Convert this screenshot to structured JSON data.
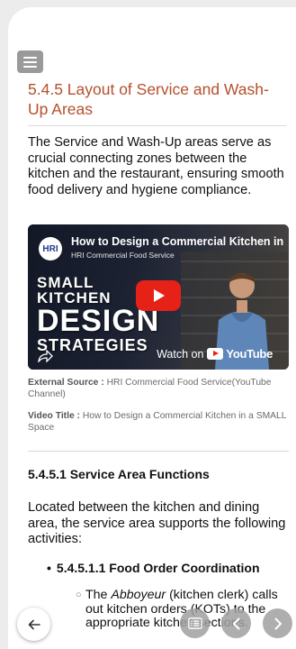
{
  "section": {
    "title": "5.4.5 Layout of Service and Wash-Up Areas",
    "intro": "The Service and Wash-Up areas serve as crucial connecting zones between the kitchen and the restaurant, ensuring smooth food delivery and hygiene compliance."
  },
  "video": {
    "channel_logo": "HRI",
    "title": "How to Design a Commercial Kitchen in a SMALL Space",
    "channel": "HRI Commercial Food Service",
    "thumb_line1": "SMALL",
    "thumb_line2": "KITCHEN",
    "thumb_line3": "DESIGN",
    "thumb_line4": "STRATEGIES",
    "watch_on": "Watch on",
    "youtube": "YouTube"
  },
  "meta": {
    "source_label": "External Source :",
    "source_value": "HRI Commercial Food Service(YouTube Channel)",
    "title_label": "Video Title :",
    "title_value": "How to Design a Commercial Kitchen in a SMALL Space"
  },
  "subsection": {
    "heading": "5.4.5.1 Service Area Functions",
    "para": "Located between the kitchen and dining area, the service area supports the following activities:",
    "bullet_heading": "5.4.5.1.1 Food Order Coordination",
    "sub_bullet_pre": "The ",
    "sub_bullet_em": "Abboyeur",
    "sub_bullet_post": " (kitchen clerk) calls out kitchen orders (KOTs) to the appropriate kitchen sections."
  },
  "icons": {
    "menu": "hamburger-menu-icon",
    "back": "arrow-left-icon",
    "toc": "list-icon",
    "prev": "chevron-left-icon",
    "next": "chevron-right-icon",
    "play": "play-icon",
    "share": "share-icon"
  },
  "colors": {
    "title": "#b5502c",
    "play": "#e62117",
    "nav_button": "#a0a0a0"
  }
}
